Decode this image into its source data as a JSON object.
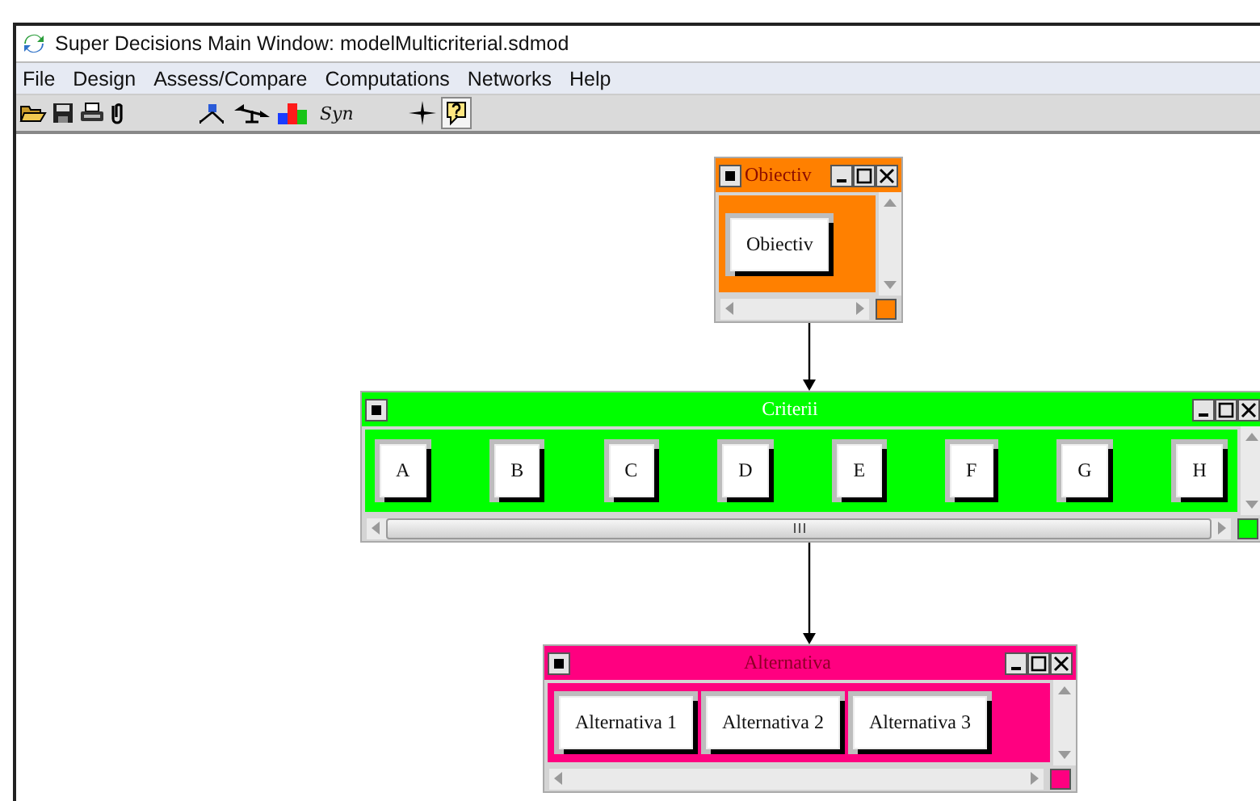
{
  "window": {
    "title": "Super Decisions Main Window: modelMulticriterial.sdmod"
  },
  "menu": [
    "File",
    "Design",
    "Assess/Compare",
    "Computations",
    "Networks",
    "Help"
  ],
  "toolbar": {
    "syn_label": "Syn",
    "help_pressed": true
  },
  "clusters": [
    {
      "name": "Obiectiv",
      "color": "#ff8000",
      "nodes": [
        "Obiectiv"
      ]
    },
    {
      "name": "Criterii",
      "color": "#00ff00",
      "nodes": [
        "A",
        "B",
        "C",
        "D",
        "E",
        "F",
        "G",
        "H"
      ]
    },
    {
      "name": "Alternativa",
      "color": "#ff0080",
      "nodes": [
        "Alternativa 1",
        "Alternativa 2",
        "Alternativa 3"
      ]
    }
  ]
}
